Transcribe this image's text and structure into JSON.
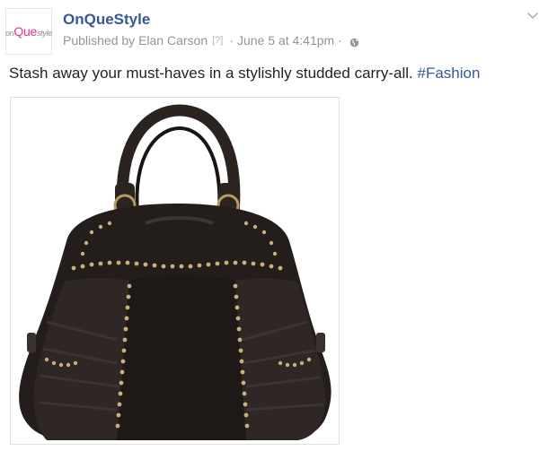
{
  "post": {
    "page_name": "OnQueStyle",
    "avatar_logo": {
      "on": "on",
      "que": "Que",
      "style": "style"
    },
    "published_prefix": "Published by",
    "author": "Elan Carson",
    "help_mark": "[?]",
    "separator": "·",
    "timestamp": "June 5 at 4:41pm",
    "text": "Stash away your must-haves in a stylishly studded carry-all.",
    "hashtag": "#Fashion",
    "photo_alt": "Black leather studded handbag",
    "icons": [
      "globe-icon",
      "chevron-down-icon"
    ]
  },
  "colors": {
    "link": "#365899",
    "meta": "#90949c",
    "text": "#1d2129",
    "logo_accent": "#e0338a"
  }
}
